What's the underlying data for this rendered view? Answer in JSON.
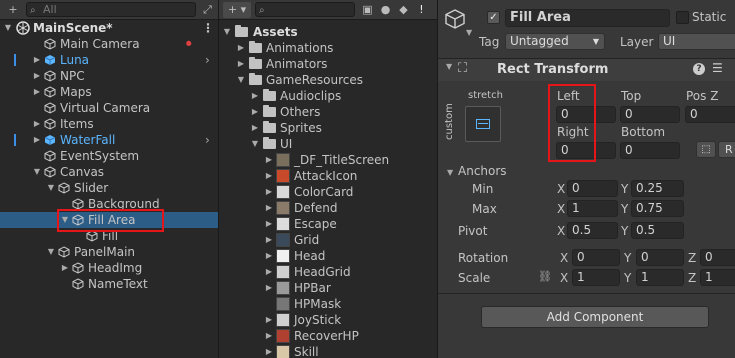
{
  "hierarchy": {
    "search_placeholder": "All",
    "add_glyph": "+",
    "scene_name": "MainScene*",
    "more_glyph": "⋮",
    "items": [
      {
        "label": "Main Camera",
        "depth": 1,
        "arrow": "",
        "blue": false
      },
      {
        "label": "Luna",
        "depth": 1,
        "arrow": "▶",
        "blue": true
      },
      {
        "label": "NPC",
        "depth": 1,
        "arrow": "▶",
        "blue": false
      },
      {
        "label": "Maps",
        "depth": 1,
        "arrow": "▶",
        "blue": false
      },
      {
        "label": "Virtual Camera",
        "depth": 1,
        "arrow": "",
        "blue": false
      },
      {
        "label": "Items",
        "depth": 1,
        "arrow": "▶",
        "blue": false
      },
      {
        "label": "WaterFall",
        "depth": 1,
        "arrow": "▶",
        "blue": true
      },
      {
        "label": "EventSystem",
        "depth": 1,
        "arrow": "",
        "blue": false
      },
      {
        "label": "Canvas",
        "depth": 1,
        "arrow": "▼",
        "blue": false
      },
      {
        "label": "Slider",
        "depth": 2,
        "arrow": "▼",
        "blue": false
      },
      {
        "label": "Background",
        "depth": 3,
        "arrow": "",
        "blue": false
      },
      {
        "label": "Fill Area",
        "depth": 3,
        "arrow": "▼",
        "blue": false
      },
      {
        "label": "Fill",
        "depth": 4,
        "arrow": "",
        "blue": false
      },
      {
        "label": "PanelMain",
        "depth": 2,
        "arrow": "▼",
        "blue": false
      },
      {
        "label": "HeadImg",
        "depth": 3,
        "arrow": "▶",
        "blue": false
      },
      {
        "label": "NameText",
        "depth": 3,
        "arrow": "",
        "blue": false
      }
    ]
  },
  "project": {
    "add_glyph": "+",
    "root": "Assets",
    "items": [
      {
        "label": "Animations",
        "depth": 1,
        "arrow": "▶",
        "kind": "folder"
      },
      {
        "label": "Animators",
        "depth": 1,
        "arrow": "▶",
        "kind": "folder"
      },
      {
        "label": "GameResources",
        "depth": 1,
        "arrow": "▼",
        "kind": "folder"
      },
      {
        "label": "Audioclips",
        "depth": 2,
        "arrow": "▶",
        "kind": "folder"
      },
      {
        "label": "Others",
        "depth": 2,
        "arrow": "▶",
        "kind": "folder"
      },
      {
        "label": "Sprites",
        "depth": 2,
        "arrow": "▶",
        "kind": "folder"
      },
      {
        "label": "UI",
        "depth": 2,
        "arrow": "▼",
        "kind": "folder"
      },
      {
        "label": "_DF_TitleScreen",
        "depth": 3,
        "arrow": "▶",
        "kind": "thumb"
      },
      {
        "label": "AttackIcon",
        "depth": 3,
        "arrow": "▶",
        "kind": "thumb"
      },
      {
        "label": "ColorCard",
        "depth": 3,
        "arrow": "▶",
        "kind": "thumb"
      },
      {
        "label": "Defend",
        "depth": 3,
        "arrow": "▶",
        "kind": "thumb"
      },
      {
        "label": "Escape",
        "depth": 3,
        "arrow": "▶",
        "kind": "thumb"
      },
      {
        "label": "Grid",
        "depth": 3,
        "arrow": "▶",
        "kind": "thumb"
      },
      {
        "label": "Head",
        "depth": 3,
        "arrow": "▶",
        "kind": "thumb"
      },
      {
        "label": "HeadGrid",
        "depth": 3,
        "arrow": "▶",
        "kind": "thumb"
      },
      {
        "label": "HPBar",
        "depth": 3,
        "arrow": "▶",
        "kind": "thumb"
      },
      {
        "label": "HPMask",
        "depth": 3,
        "arrow": "",
        "kind": "thumb"
      },
      {
        "label": "JoyStick",
        "depth": 3,
        "arrow": "▶",
        "kind": "thumb"
      },
      {
        "label": "RecoverHP",
        "depth": 3,
        "arrow": "▶",
        "kind": "thumb"
      },
      {
        "label": "Skill",
        "depth": 3,
        "arrow": "▶",
        "kind": "thumb"
      }
    ]
  },
  "inspector": {
    "object_name": "Fill Area",
    "static_label": "Static",
    "tag_label": "Tag",
    "tag_value": "Untagged",
    "layer_label": "Layer",
    "layer_value": "UI",
    "component_title": "Rect Transform",
    "help_glyph": "?",
    "stretch_label": "stretch",
    "custom_label": "custom",
    "left_label": "Left",
    "left_value": "0",
    "top_label": "Top",
    "top_value": "0",
    "posz_label": "Pos Z",
    "posz_value": "0",
    "right_label": "Right",
    "right_value": "0",
    "bottom_label": "Bottom",
    "bottom_value": "0",
    "r_button": "R",
    "anchors_label": "Anchors",
    "min_label": "Min",
    "min_x": "0",
    "min_y": "0.25",
    "max_label": "Max",
    "max_x": "1",
    "max_y": "0.75",
    "pivot_label": "Pivot",
    "pivot_x": "0.5",
    "pivot_y": "0.5",
    "rotation_label": "Rotation",
    "rot_x": "0",
    "rot_y": "0",
    "rot_z": "0",
    "scale_label": "Scale",
    "scale_x": "1",
    "scale_y": "1",
    "scale_z": "1",
    "x_axis": "X",
    "y_axis": "Y",
    "z_axis": "Z",
    "add_component": "Add Component"
  }
}
